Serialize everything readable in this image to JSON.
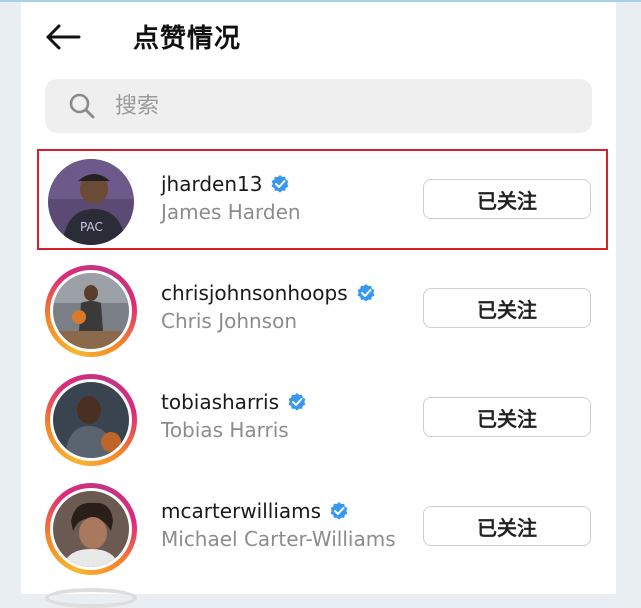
{
  "header": {
    "title": "点赞情况"
  },
  "search": {
    "placeholder": "搜索"
  },
  "users": [
    {
      "username": "jharden13",
      "fullname": "James Harden",
      "button": "已关注",
      "story_ring": false
    },
    {
      "username": "chrisjohnsonhoops",
      "fullname": "Chris Johnson",
      "button": "已关注",
      "story_ring": true
    },
    {
      "username": "tobiasharris",
      "fullname": "Tobias Harris",
      "button": "已关注",
      "story_ring": true
    },
    {
      "username": "mcarterwilliams",
      "fullname": "Michael Carter-Williams",
      "button": "已关注",
      "story_ring": true
    }
  ],
  "colors": {
    "verified": "#3897f0",
    "highlight": "#d8202a"
  }
}
